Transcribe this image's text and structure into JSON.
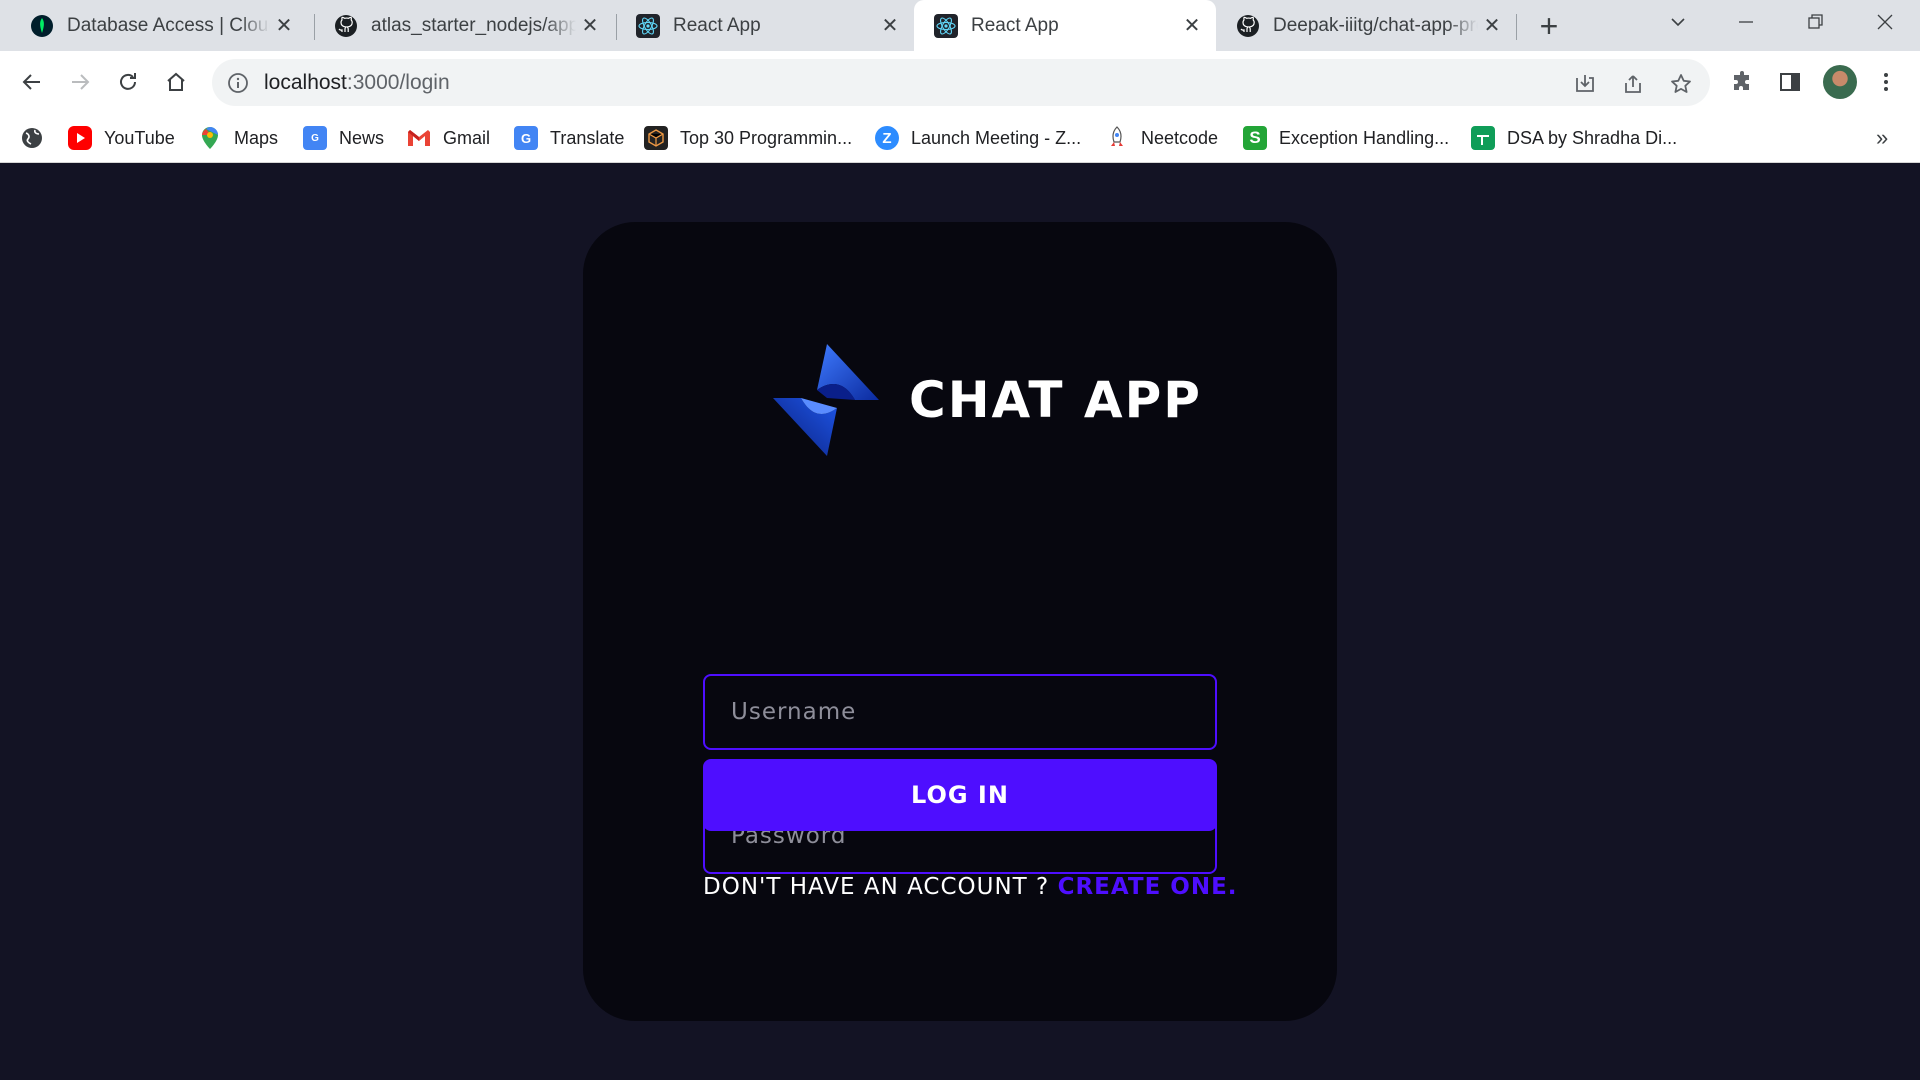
{
  "browser": {
    "tabs": [
      {
        "title": "Database Access | Cloud: MongoDB Cloud",
        "favicon": "mongodb-leaf-icon",
        "active": false
      },
      {
        "title": "atlas_starter_nodejs/app.js",
        "favicon": "github-icon",
        "active": false
      },
      {
        "title": "React App",
        "favicon": "react-icon",
        "active": false
      },
      {
        "title": "React App",
        "favicon": "react-icon",
        "active": true
      },
      {
        "title": "Deepak-iiitg/chat-app-project",
        "favicon": "github-icon",
        "active": false
      }
    ],
    "new_tab_label": "+",
    "address": {
      "host": "localhost",
      "rest": ":3000/login"
    },
    "bookmarks": [
      {
        "label": "",
        "icon": "globe-icon"
      },
      {
        "label": "YouTube",
        "icon": "youtube-icon"
      },
      {
        "label": "Maps",
        "icon": "maps-icon"
      },
      {
        "label": "News",
        "icon": "news-icon"
      },
      {
        "label": "Gmail",
        "icon": "gmail-icon"
      },
      {
        "label": "Translate",
        "icon": "translate-icon"
      },
      {
        "label": "Top 30 Programmin...",
        "icon": "cube-icon"
      },
      {
        "label": "Launch Meeting - Z...",
        "icon": "zoom-icon"
      },
      {
        "label": "Neetcode",
        "icon": "rocket-icon"
      },
      {
        "label": "Exception Handling...",
        "icon": "s-icon"
      },
      {
        "label": "DSA by Shradha Di...",
        "icon": "sheets-icon"
      }
    ],
    "bookmarks_more": "»"
  },
  "app": {
    "brand_name": "CHAT APP",
    "username_placeholder": "Username",
    "password_placeholder": "Password",
    "login_label": "LOG IN",
    "signup_prompt": "DON'T HAVE AN ACCOUNT ? ",
    "signup_link": "CREATE ONE."
  },
  "colors": {
    "page_bg": "#131324",
    "card_bg": "#07070f",
    "accent": "#4e0eff"
  }
}
